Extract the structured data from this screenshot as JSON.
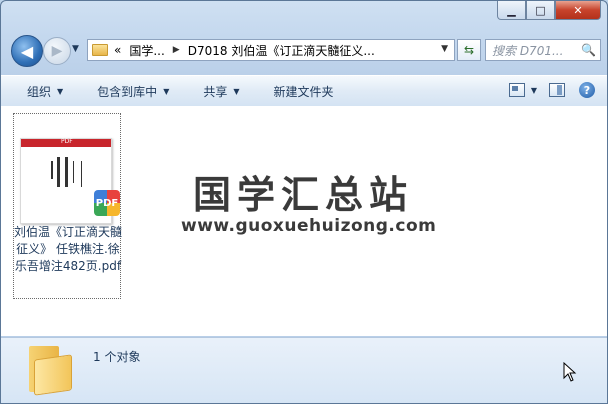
{
  "window": {
    "caption_buttons": {
      "minimize": "▁",
      "maximize": "□",
      "close": "✕"
    }
  },
  "nav": {
    "back_glyph": "◀",
    "forward_glyph": "▶",
    "dropdown_glyph": "▼",
    "address": {
      "chevrons": "«",
      "crumb1": "国学...",
      "separator": "▶",
      "crumb2": "D7018 刘伯温《订正滴天髓征义...",
      "dropdown_glyph": "▼"
    },
    "refresh_glyph": "⇆",
    "search_placeholder": "搜索 D701...",
    "search_icon": "🔍"
  },
  "toolbar": {
    "organize": "组织",
    "include_in_library": "包含到库中",
    "share": "共享",
    "new_folder": "新建文件夹",
    "arrow": "▼",
    "help": "?"
  },
  "content": {
    "file": {
      "name": "刘伯温《订正滴天髓征义》 任铁樵注.徐乐吾增注482页.pdf",
      "thumb_band_text": "PDF",
      "badge": "PDF"
    },
    "watermark_title": "国学汇总站",
    "watermark_url": "www.guoxuehuizong.com"
  },
  "details": {
    "count": "1 个对象"
  },
  "colors": {
    "frame": "#bcd3ea",
    "toolbar": "#dce8f5",
    "close_button": "#c7432c",
    "content_bg": "#ffffff"
  }
}
